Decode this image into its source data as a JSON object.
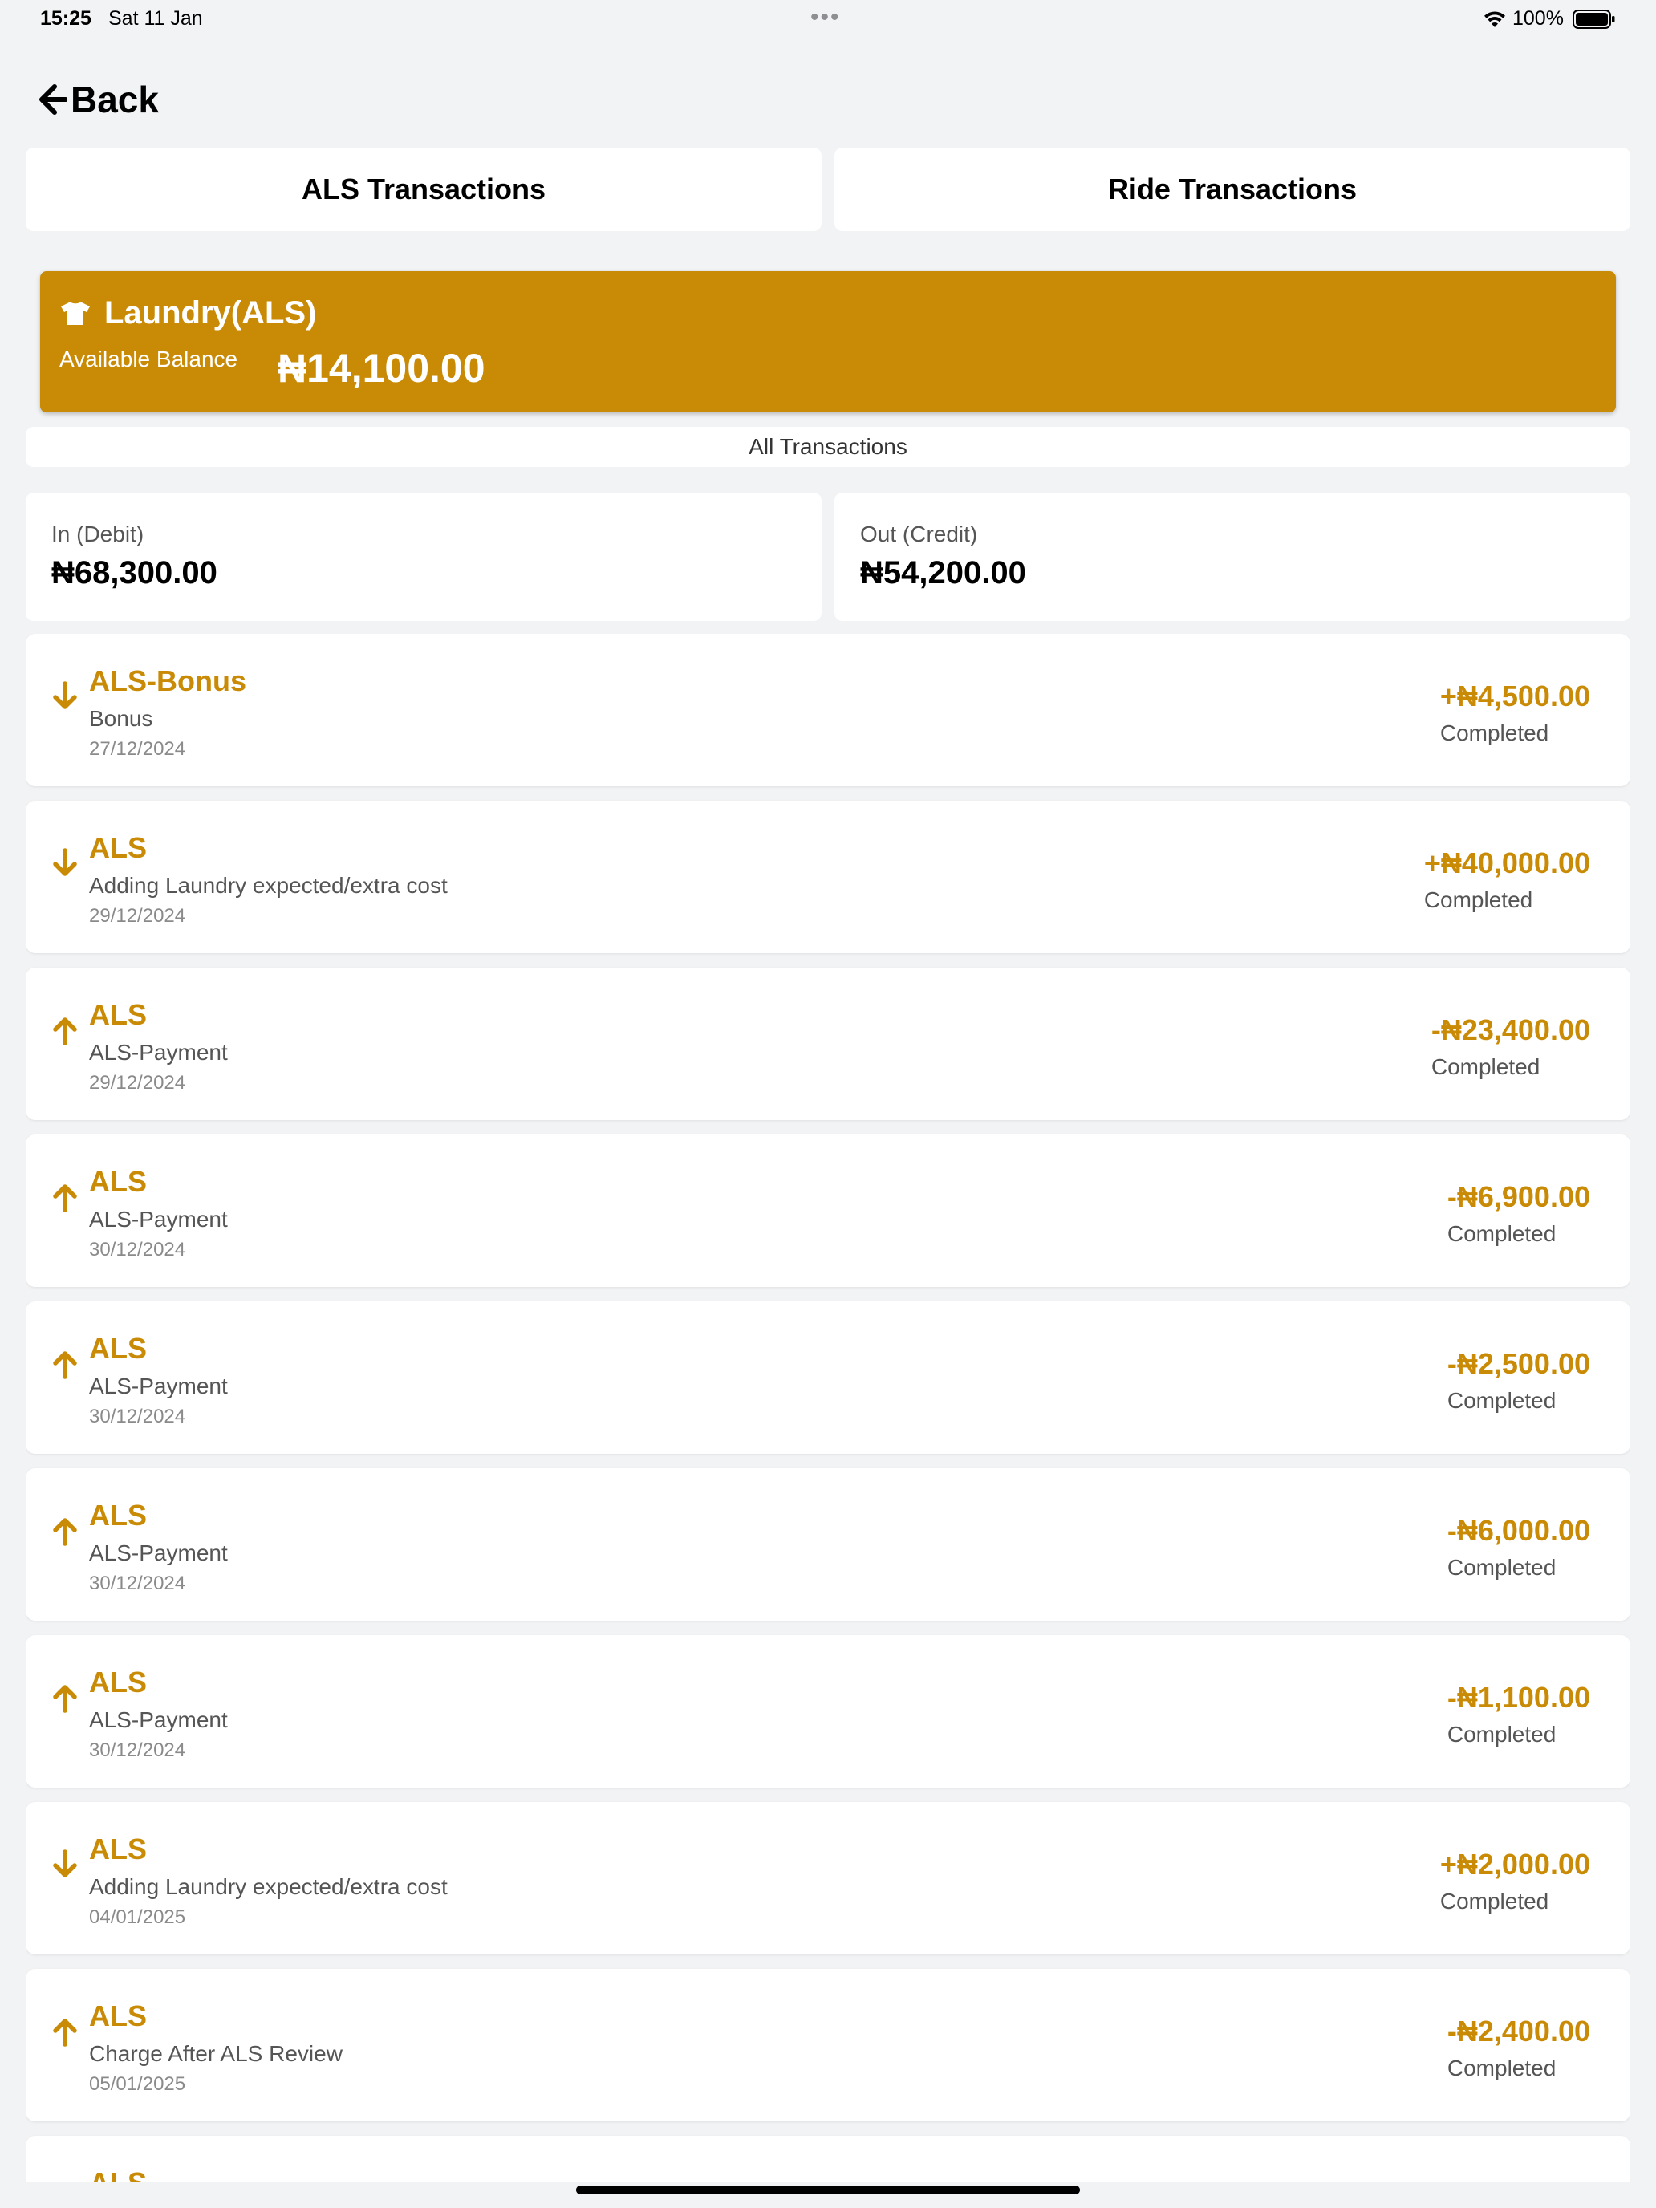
{
  "status_bar": {
    "time": "15:25",
    "date": "Sat 11 Jan",
    "battery_percent": "100%"
  },
  "nav": {
    "back_label": "Back"
  },
  "tabs": [
    {
      "label": "ALS Transactions"
    },
    {
      "label": "Ride Transactions"
    }
  ],
  "balance": {
    "title": "Laundry(ALS)",
    "available_label": "Available Balance",
    "amount": "₦14,100.00",
    "icon": "tshirt-icon",
    "color": "#c98a05"
  },
  "filter": {
    "label": "All Transactions"
  },
  "summary": {
    "in_label": "In (Debit)",
    "in_amount": "₦68,300.00",
    "out_label": "Out (Credit)",
    "out_amount": "₦54,200.00"
  },
  "transactions": [
    {
      "title": "ALS-Bonus",
      "description": "Bonus",
      "date": "27/12/2024",
      "amount": "+₦4,500.00",
      "status": "Completed",
      "direction": "in"
    },
    {
      "title": "ALS",
      "description": "Adding Laundry expected/extra cost",
      "date": "29/12/2024",
      "amount": "+₦40,000.00",
      "status": "Completed",
      "direction": "in"
    },
    {
      "title": "ALS",
      "description": "ALS-Payment",
      "date": "29/12/2024",
      "amount": "-₦23,400.00",
      "status": "Completed",
      "direction": "out"
    },
    {
      "title": "ALS",
      "description": "ALS-Payment",
      "date": "30/12/2024",
      "amount": "-₦6,900.00",
      "status": "Completed",
      "direction": "out"
    },
    {
      "title": "ALS",
      "description": "ALS-Payment",
      "date": "30/12/2024",
      "amount": "-₦2,500.00",
      "status": "Completed",
      "direction": "out"
    },
    {
      "title": "ALS",
      "description": "ALS-Payment",
      "date": "30/12/2024",
      "amount": "-₦6,000.00",
      "status": "Completed",
      "direction": "out"
    },
    {
      "title": "ALS",
      "description": "ALS-Payment",
      "date": "30/12/2024",
      "amount": "-₦1,100.00",
      "status": "Completed",
      "direction": "out"
    },
    {
      "title": "ALS",
      "description": "Adding Laundry expected/extra cost",
      "date": "04/01/2025",
      "amount": "+₦2,000.00",
      "status": "Completed",
      "direction": "in"
    },
    {
      "title": "ALS",
      "description": "Charge After ALS Review",
      "date": "05/01/2025",
      "amount": "-₦2,400.00",
      "status": "Completed",
      "direction": "out"
    },
    {
      "title": "ALS",
      "description": "",
      "date": "",
      "amount": "",
      "status": "",
      "direction": "out"
    }
  ]
}
